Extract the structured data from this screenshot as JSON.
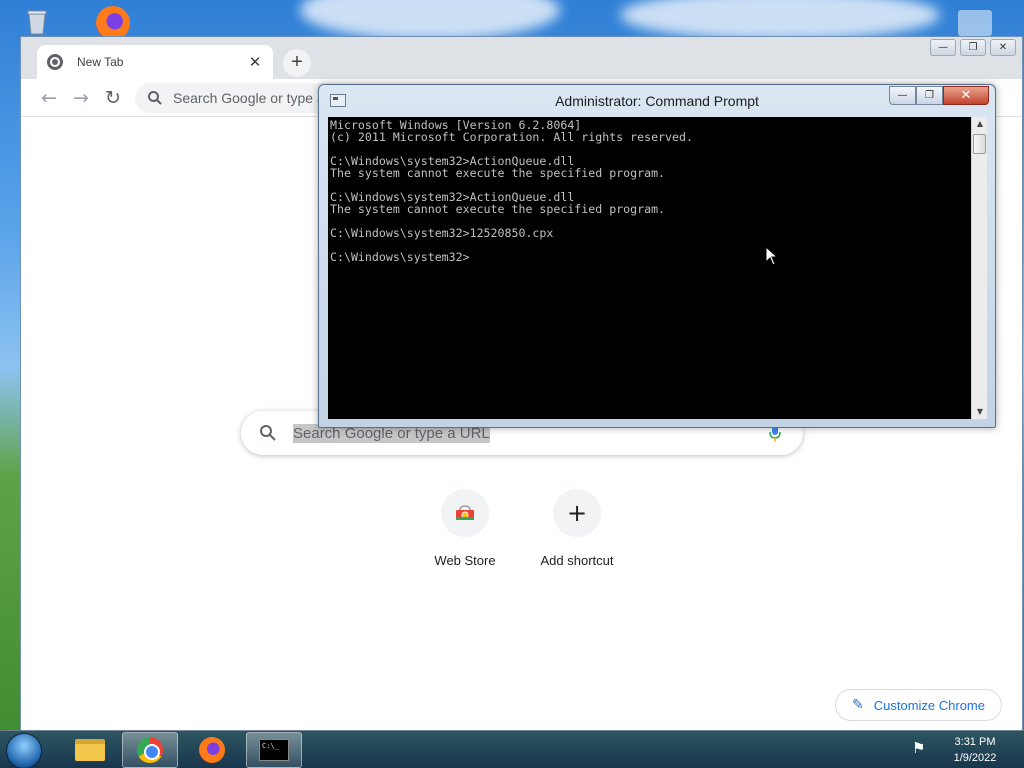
{
  "chrome": {
    "tab_title": "New Tab",
    "omnibox_placeholder": "Search Google or type a URL",
    "search_box_text": "Search Google or type a URL",
    "shortcuts": [
      {
        "label": "Web Store",
        "icon": "webstore-icon"
      },
      {
        "label": "Add shortcut",
        "icon": "plus-icon"
      }
    ],
    "customize_label": "Customize Chrome"
  },
  "cmd": {
    "title": "Administrator: Command Prompt",
    "lines": [
      "Microsoft Windows [Version 6.2.8064]",
      "(c) 2011 Microsoft Corporation. All rights reserved.",
      "",
      "C:\\Windows\\system32>ActionQueue.dll",
      "The system cannot execute the specified program.",
      "",
      "C:\\Windows\\system32>ActionQueue.dll",
      "The system cannot execute the specified program.",
      "",
      "C:\\Windows\\system32>12520850.cpx",
      "",
      "C:\\Windows\\system32>"
    ]
  },
  "taskbar": {
    "apps": [
      "file-explorer",
      "chrome",
      "firefox",
      "command-prompt"
    ],
    "clock_time": "3:31 PM",
    "clock_date": "1/9/2022"
  },
  "colors": {
    "chrome_accent": "#1a73e8",
    "console_bg": "#000000",
    "console_text": "#c0c0c0",
    "close_button": "#c24430"
  }
}
